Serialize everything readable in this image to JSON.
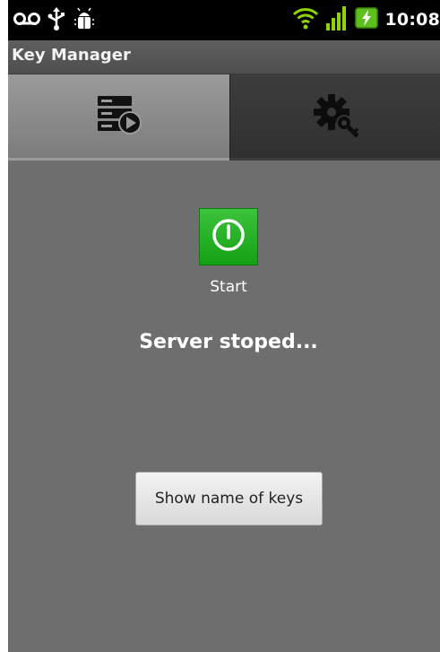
{
  "status_bar": {
    "time": "10:08",
    "left_icons": [
      "voicemail-icon",
      "usb-icon",
      "debug-bug-icon"
    ],
    "right_icons": [
      "wifi-icon",
      "signal-icon",
      "battery-charging-icon"
    ]
  },
  "app": {
    "title": "Key Manager"
  },
  "tabs": [
    {
      "name": "server",
      "icon": "server-play-icon",
      "selected": true
    },
    {
      "name": "settings",
      "icon": "gear-key-icon",
      "selected": false
    }
  ],
  "main": {
    "start_label": "Start",
    "server_status": "Server stoped...",
    "show_keys_label": "Show name of keys"
  },
  "colors": {
    "background": "#6e6e6e",
    "start_button": "#22aa22",
    "selected_tab": "#8c8c8c",
    "unselected_tab": "#363636"
  }
}
